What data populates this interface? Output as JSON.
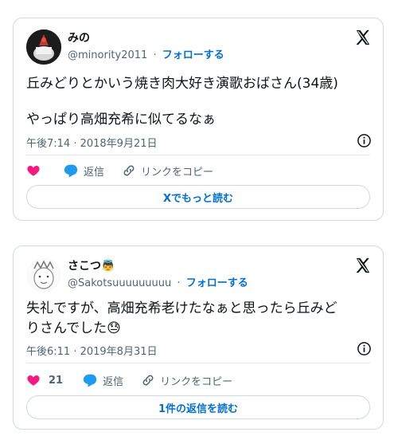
{
  "colors": {
    "accent": "#006fd6",
    "like": "#f91880",
    "muted": "#536471",
    "border": "#cfd9de"
  },
  "tweets": [
    {
      "name": "みの",
      "handle": "@minority2011",
      "separator": "·",
      "follow": "フォローする",
      "text_line1": "丘みどりとかいう焼き肉大好き演歌おばさん(34歳)",
      "text_line2": "やっぱり高畑充希に似てるなぁ",
      "timestamp": "午後7:14 · 2018年9月21日",
      "likes": "",
      "reply": "返信",
      "copy_link": "リンクをコピー",
      "more_button": "Xでもっと読む",
      "icons": [
        "x-logo-icon",
        "info-icon",
        "heart-icon",
        "reply-bubble-icon",
        "link-icon"
      ]
    },
    {
      "name": "さこつ",
      "name_emoji": "👼",
      "handle": "@Sakotsuuuuuuuuu",
      "separator": "·",
      "follow": "フォローする",
      "text_line1": "失礼ですが、高畑充希老けたなぁと思ったら丘みど",
      "text_line2": "りさんでした😓",
      "timestamp": "午後6:11 · 2019年8月31日",
      "likes": "21",
      "reply": "返信",
      "copy_link": "リンクをコピー",
      "more_button": "1件の返信を読む",
      "icons": [
        "x-logo-icon",
        "info-icon",
        "heart-icon",
        "reply-bubble-icon",
        "link-icon"
      ]
    }
  ]
}
